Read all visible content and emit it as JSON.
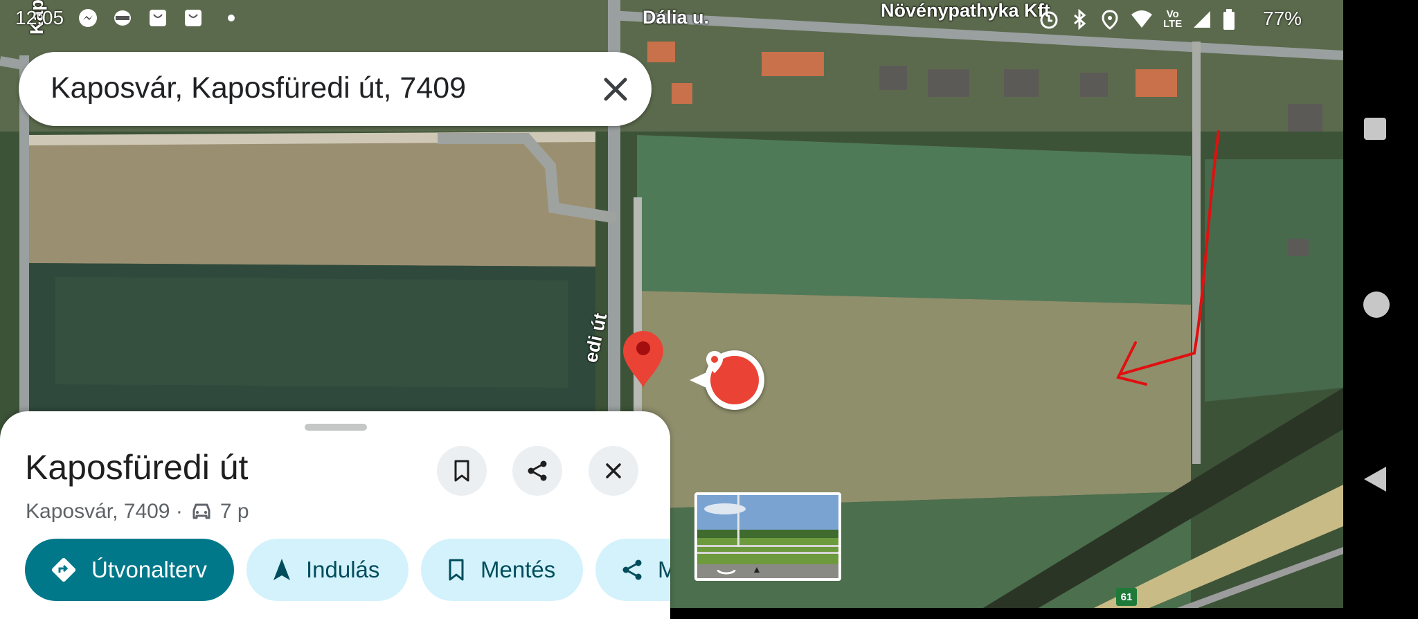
{
  "status_bar": {
    "time": "12:05",
    "battery": "77%",
    "network": "LTE",
    "notification_icons": [
      "messenger-icon",
      "burger-king-icon",
      "shopping-bag-icon",
      "shopping-bag-icon",
      "dot-icon"
    ]
  },
  "map": {
    "poi_label": "Növénypathyka Kft",
    "street_top": "Dália u.",
    "street_vertical": "edi út",
    "street_left": "Kapo",
    "road_number": "61"
  },
  "search": {
    "query": "Kaposvár, Kaposfüredi út, 7409",
    "clear_icon": "close-icon"
  },
  "place": {
    "title": "Kaposfüredi út",
    "subtitle_city": "Kaposvár, 7409 ·",
    "travel_time": "7 p"
  },
  "actions": {
    "route": "Útvonalterv",
    "start": "Indulás",
    "save": "Mentés",
    "share": "M"
  },
  "colors": {
    "primary": "#00788a",
    "chip_bg": "#d3f2fb",
    "marker_red": "#ea4335",
    "annotation_red": "#e01010"
  }
}
